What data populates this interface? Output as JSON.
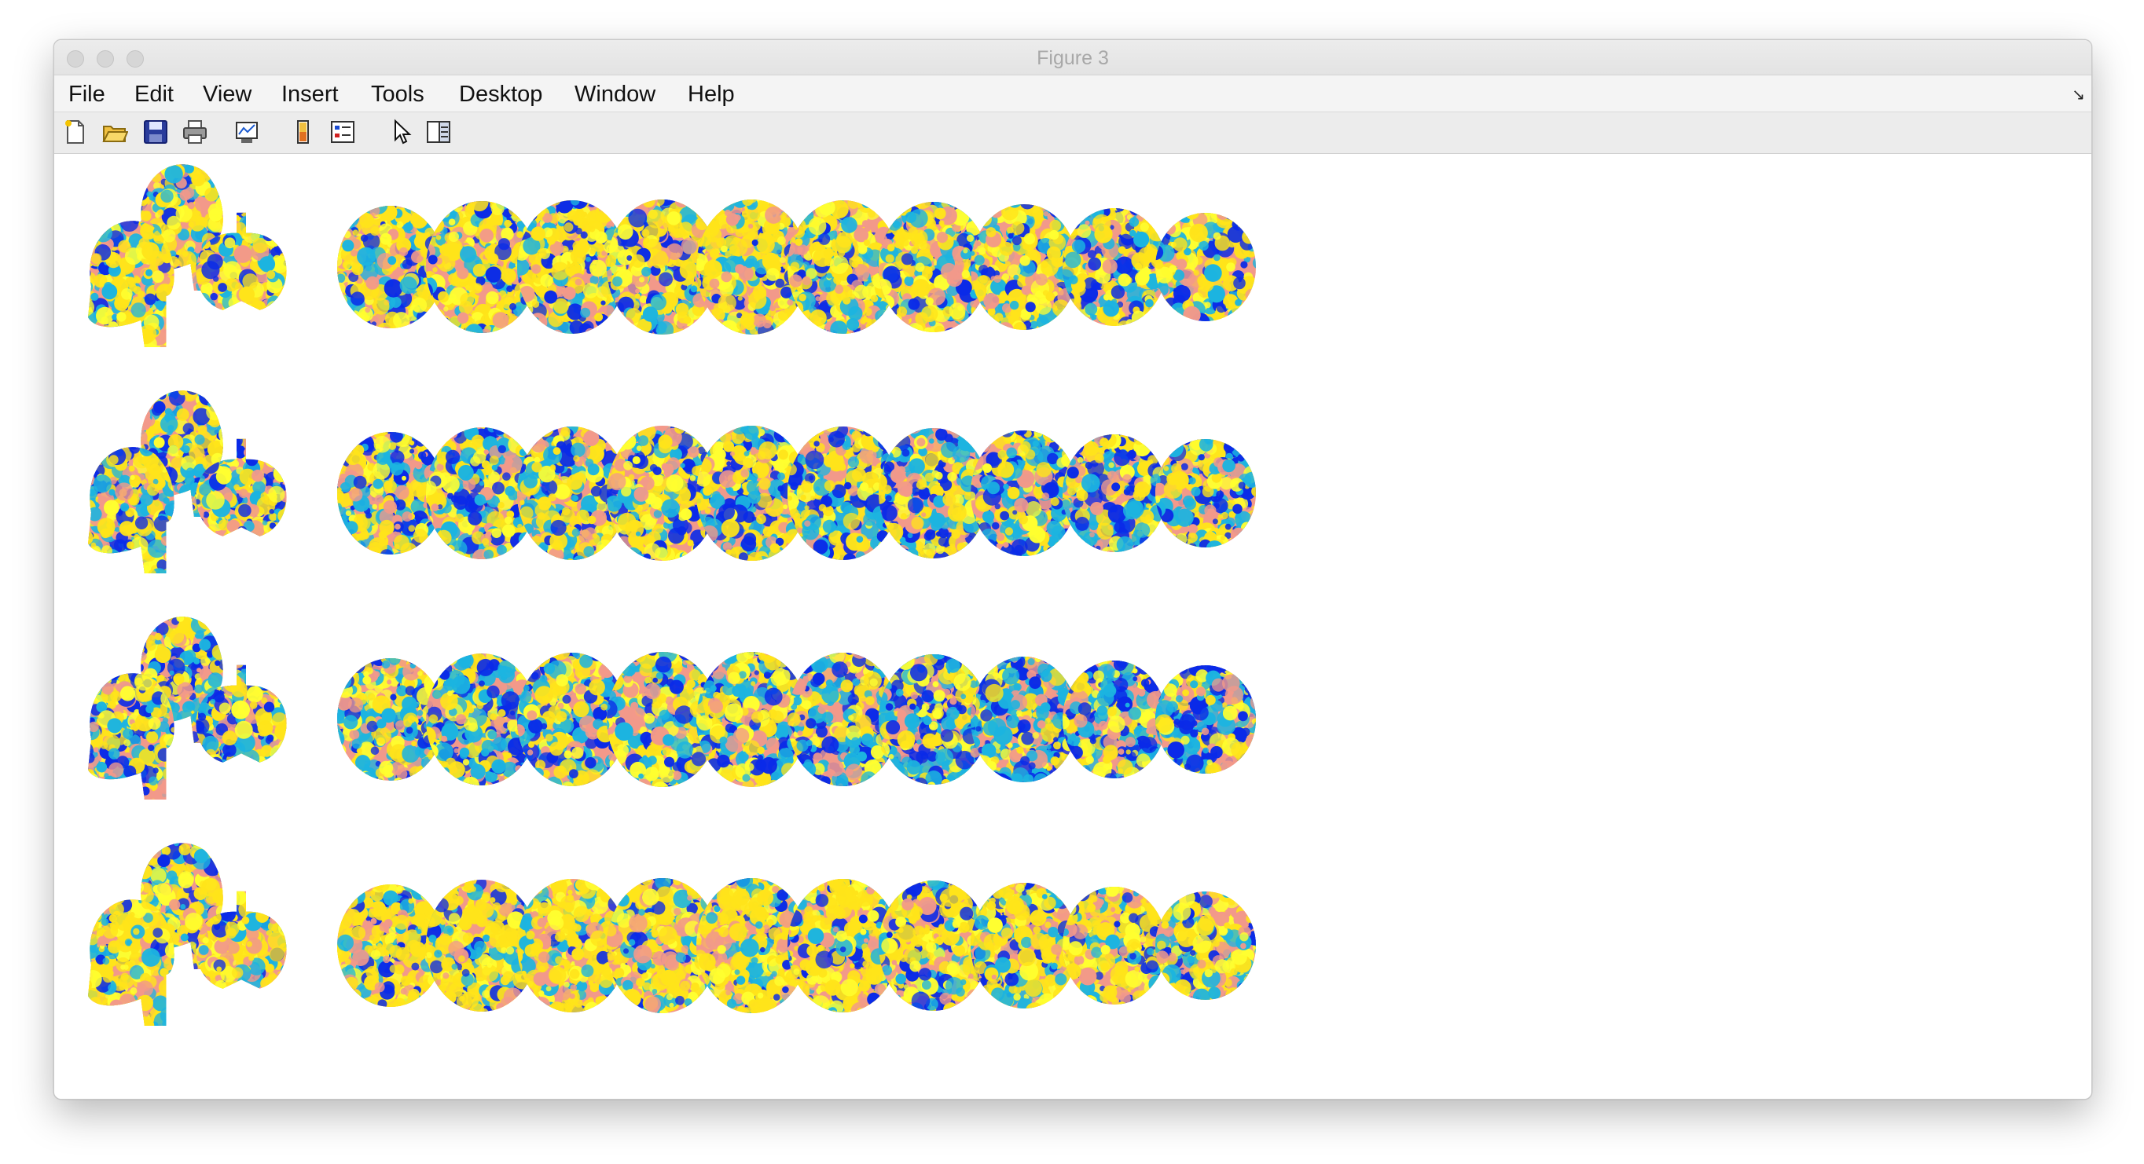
{
  "window": {
    "title": "Figure 3"
  },
  "menu": {
    "items": [
      {
        "key": "file",
        "label": "File"
      },
      {
        "key": "edit",
        "label": "Edit"
      },
      {
        "key": "view",
        "label": "View"
      },
      {
        "key": "insert",
        "label": "Insert"
      },
      {
        "key": "tools",
        "label": "Tools"
      },
      {
        "key": "desktop",
        "label": "Desktop"
      },
      {
        "key": "window",
        "label": "Window"
      },
      {
        "key": "help",
        "label": "Help"
      }
    ],
    "grip_icon": "menu-grip-icon"
  },
  "toolbar": {
    "buttons": [
      {
        "key": "new",
        "icon": "new-figure-icon"
      },
      {
        "key": "open",
        "icon": "open-file-icon"
      },
      {
        "key": "save",
        "icon": "save-icon"
      },
      {
        "key": "print",
        "icon": "print-icon"
      },
      {
        "key": "link",
        "icon": "link-plot-icon"
      },
      {
        "key": "colorbar",
        "icon": "insert-colorbar-icon"
      },
      {
        "key": "legend",
        "icon": "insert-legend-icon"
      },
      {
        "key": "edit-plot",
        "icon": "edit-plot-icon"
      },
      {
        "key": "property-inspector",
        "icon": "property-inspector-icon"
      }
    ]
  },
  "figure": {
    "rows": 4,
    "sagittal_views_per_row": 2,
    "axial_slices_per_row": 11,
    "colormap": [
      "#0a2ae8",
      "#1cb4e0",
      "#f2998a",
      "#ffe41a",
      "#ffff30"
    ]
  }
}
